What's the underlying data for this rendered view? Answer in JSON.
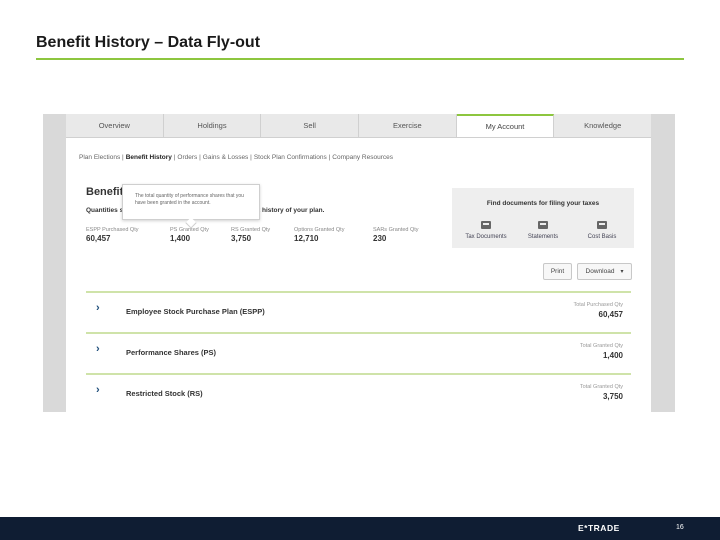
{
  "slide": {
    "title": "Benefit History – Data Fly-out",
    "page_number": "16",
    "brand": "E*TRADE",
    "accent_color": "#8dc63f",
    "footer_color": "#0f1d33"
  },
  "tabs": [
    {
      "label": "Overview",
      "active": false
    },
    {
      "label": "Holdings",
      "active": false
    },
    {
      "label": "Sell",
      "active": false
    },
    {
      "label": "Exercise",
      "active": false
    },
    {
      "label": "My Account",
      "active": true
    },
    {
      "label": "Knowledge",
      "active": false
    }
  ],
  "subnav": [
    {
      "label": "Plan Elections |",
      "active": false
    },
    {
      "label": "Benefit History",
      "active": true
    },
    {
      "label": "| Orders |",
      "active": false
    },
    {
      "label": "Gains & Losses |",
      "active": false
    },
    {
      "label": "Stock Plan Confirmations |",
      "active": false
    },
    {
      "label": "Company Resources",
      "active": false
    }
  ],
  "section": {
    "heading": "Benefit",
    "sub_left": "Quantities s",
    "sub_right": "t history of your plan."
  },
  "tooltip": {
    "text": "The total quantity of performance shares that you have been granted in the account."
  },
  "stats": [
    {
      "label": "ESPP Purchased Qty",
      "value": "60,457"
    },
    {
      "label": "PS Granted Qty",
      "value": "1,400"
    },
    {
      "label": "RS Granted Qty",
      "value": "3,750"
    },
    {
      "label": "Options Granted Qty",
      "value": "12,710"
    },
    {
      "label": "SARs Granted Qty",
      "value": "230"
    }
  ],
  "documents": {
    "title": "Find documents for filing your taxes",
    "items": [
      {
        "label": "Tax Documents",
        "icon": "inbox-icon"
      },
      {
        "label": "Statements",
        "icon": "inbox-icon"
      },
      {
        "label": "Cost Basis",
        "icon": "inbox-icon"
      }
    ]
  },
  "buttons": {
    "print": "Print",
    "download": "Download",
    "download_caret": "▾"
  },
  "plans": [
    {
      "chevron": "›",
      "title": "Employee Stock Purchase Plan (ESPP)",
      "qty_label": "Total Purchased Qty",
      "qty_value": "60,457"
    },
    {
      "chevron": "›",
      "title": "Performance Shares (PS)",
      "qty_label": "Total Granted Qty",
      "qty_value": "1,400"
    },
    {
      "chevron": "›",
      "title": "Restricted Stock (RS)",
      "qty_label": "Total Granted Qty",
      "qty_value": "3,750"
    }
  ]
}
